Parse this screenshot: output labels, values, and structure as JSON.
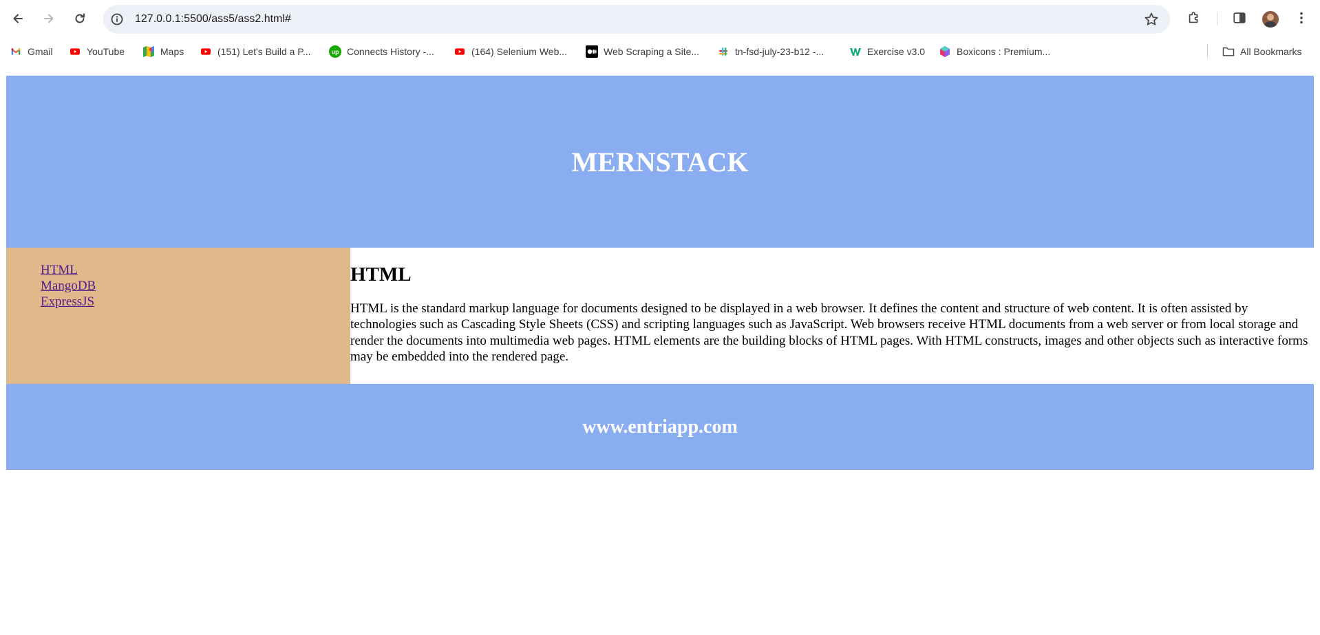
{
  "browser": {
    "url": "127.0.0.1:5500/ass5/ass2.html#",
    "bookmarks": [
      {
        "label": "Gmail",
        "icon": "gmail-icon"
      },
      {
        "label": "YouTube",
        "icon": "youtube-icon"
      },
      {
        "label": "Maps",
        "icon": "maps-icon"
      },
      {
        "label": "(151) Let's Build a P...",
        "icon": "youtube-icon"
      },
      {
        "label": "Connects History -...",
        "icon": "upwork-icon"
      },
      {
        "label": "(164) Selenium Web...",
        "icon": "youtube-icon"
      },
      {
        "label": "Web Scraping a Site...",
        "icon": "medium-icon"
      },
      {
        "label": "tn-fsd-july-23-b12 -...",
        "icon": "slack-icon"
      },
      {
        "label": "Exercise v3.0",
        "icon": "w3schools-icon"
      },
      {
        "label": "Boxicons : Premium...",
        "icon": "boxicons-icon"
      }
    ],
    "all_bookmarks_label": "All Bookmarks"
  },
  "page": {
    "header_title": "MERNSTACK",
    "nav_links": [
      "HTML",
      "MangoDB",
      "ExpressJS"
    ],
    "main_heading": "HTML",
    "main_paragraph": "HTML is the standard markup language for documents designed to be displayed in a web browser. It defines the content and structure of web content. It is often assisted by technologies such as Cascading Style Sheets (CSS) and scripting languages such as JavaScript. Web browsers receive HTML documents from a web server or from local storage and render the documents into multimedia web pages. HTML elements are the building blocks of HTML pages. With HTML constructs, images and other objects such as interactive forms may be embedded into the rendered page.",
    "footer_text": "www.entriapp.com"
  },
  "colors": {
    "header_footer_bg": "#8aadf2",
    "sidebar_bg": "#dfb98a",
    "link_visited": "#551a8b"
  }
}
